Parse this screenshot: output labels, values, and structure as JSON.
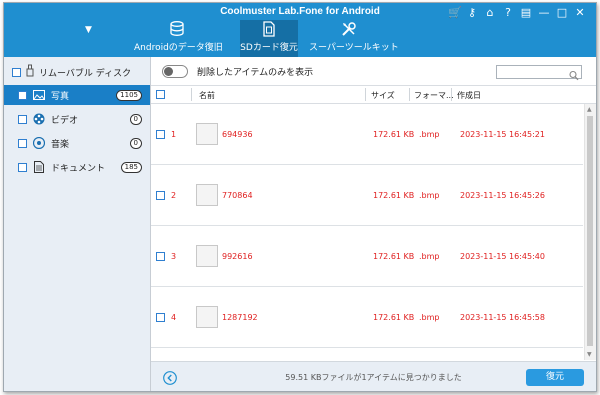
{
  "app": {
    "title": "Coolmuster Lab.Fone for Android"
  },
  "window_controls": [
    {
      "name": "cart-icon",
      "glyph": "🛒"
    },
    {
      "name": "key-icon",
      "glyph": "⚷"
    },
    {
      "name": "home-icon",
      "glyph": "⌂"
    },
    {
      "name": "help-icon",
      "glyph": "?"
    },
    {
      "name": "feedback-icon",
      "glyph": "▤"
    },
    {
      "name": "minimize-icon",
      "glyph": "—"
    },
    {
      "name": "maximize-icon",
      "glyph": "□"
    },
    {
      "name": "close-icon",
      "glyph": "✕"
    }
  ],
  "tabs": [
    {
      "label": "Androidのデータ復旧",
      "icon": "database-icon",
      "active": false
    },
    {
      "label": "SDカード復元",
      "icon": "sdcard-icon",
      "active": true
    },
    {
      "label": "スーパーツールキット",
      "icon": "tools-icon",
      "active": false
    }
  ],
  "sidebar": {
    "header": "リムーバブル ディスク",
    "items": [
      {
        "label": "写真",
        "count": "1105",
        "icon": "photo-icon",
        "active": true
      },
      {
        "label": "ビデオ",
        "count": "0",
        "icon": "video-icon",
        "active": false
      },
      {
        "label": "音楽",
        "count": "0",
        "icon": "music-icon",
        "active": false
      },
      {
        "label": "ドキュメント",
        "count": "185",
        "icon": "document-icon",
        "active": false
      }
    ]
  },
  "toolbar": {
    "toggle_label": "削除したアイテムのみを表示",
    "search_placeholder": ""
  },
  "table": {
    "headers": {
      "name": "名前",
      "size": "サイズ",
      "format": "フォーマ...",
      "created": "作成日"
    },
    "rows": [
      {
        "index": "1",
        "name": "694936",
        "size": "172.61 KB",
        "format": ".bmp",
        "created": "2023-11-15 16:45:21"
      },
      {
        "index": "2",
        "name": "770864",
        "size": "172.61 KB",
        "format": ".bmp",
        "created": "2023-11-15 16:45:26"
      },
      {
        "index": "3",
        "name": "992616",
        "size": "172.61 KB",
        "format": ".bmp",
        "created": "2023-11-15 16:45:40"
      },
      {
        "index": "4",
        "name": "1287192",
        "size": "172.61 KB",
        "format": ".bmp",
        "created": "2023-11-15 16:45:58"
      }
    ]
  },
  "status": {
    "text": "59.51 KBファイルが1アイテムに見つかりました",
    "recover_label": "復元"
  },
  "colors": {
    "title_bar": "#1f8fd0",
    "active_tab": "#156fa5",
    "sidebar_active": "#1a7fc7",
    "deleted_text": "#e02020",
    "button": "#2a9ae0"
  }
}
